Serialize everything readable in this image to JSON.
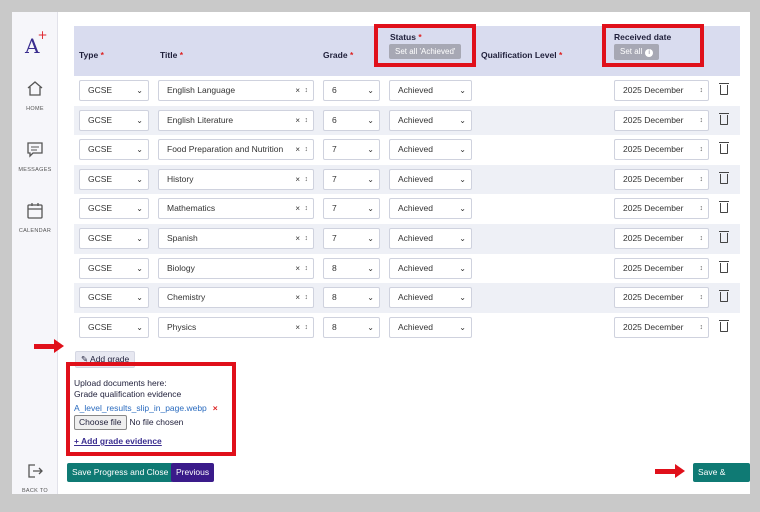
{
  "brand": {
    "logo": "A",
    "logo_plus": "+"
  },
  "nav": {
    "home": "HOME",
    "messages": "MESSAGES",
    "calendar": "CALENDAR",
    "back": "BACK TO"
  },
  "table": {
    "headers": {
      "type": "Type",
      "title": "Title",
      "grade": "Grade",
      "status": "Status",
      "qualification_level": "Qualification Level",
      "received_date": "Received date"
    },
    "set_all_achieved": "Set all 'Achieved'",
    "set_all": "Set all",
    "info_glyph": "i",
    "rows": [
      {
        "type": "GCSE",
        "title": "English Language",
        "grade": "6",
        "status": "Achieved",
        "date": "2025 December"
      },
      {
        "type": "GCSE",
        "title": "English Literature",
        "grade": "6",
        "status": "Achieved",
        "date": "2025 December"
      },
      {
        "type": "GCSE",
        "title": "Food Preparation and Nutrition",
        "grade": "7",
        "status": "Achieved",
        "date": "2025 December"
      },
      {
        "type": "GCSE",
        "title": "History",
        "grade": "7",
        "status": "Achieved",
        "date": "2025 December"
      },
      {
        "type": "GCSE",
        "title": "Mathematics",
        "grade": "7",
        "status": "Achieved",
        "date": "2025 December"
      },
      {
        "type": "GCSE",
        "title": "Spanish",
        "grade": "7",
        "status": "Achieved",
        "date": "2025 December"
      },
      {
        "type": "GCSE",
        "title": "Biology",
        "grade": "8",
        "status": "Achieved",
        "date": "2025 December"
      },
      {
        "type": "GCSE",
        "title": "Chemistry",
        "grade": "8",
        "status": "Achieved",
        "date": "2025 December"
      },
      {
        "type": "GCSE",
        "title": "Physics",
        "grade": "8",
        "status": "Achieved",
        "date": "2025 December"
      }
    ]
  },
  "add_grade": "Add grade",
  "evidence": {
    "line1": "Upload documents here:",
    "line2": "Grade qualification evidence",
    "file_name": "A_level_results_slip_in_page.webp",
    "remove": "×",
    "choose_file": "Choose file",
    "no_file": "No file chosen",
    "add_link": "+ Add grade evidence"
  },
  "footer": {
    "save_close": "Save Progress and Close",
    "previous": "Previous",
    "save_next": "Save & Next"
  },
  "colors": {
    "accent": "#3a2d8f",
    "teal": "#0f7a74",
    "highlight": "#e0101a"
  }
}
